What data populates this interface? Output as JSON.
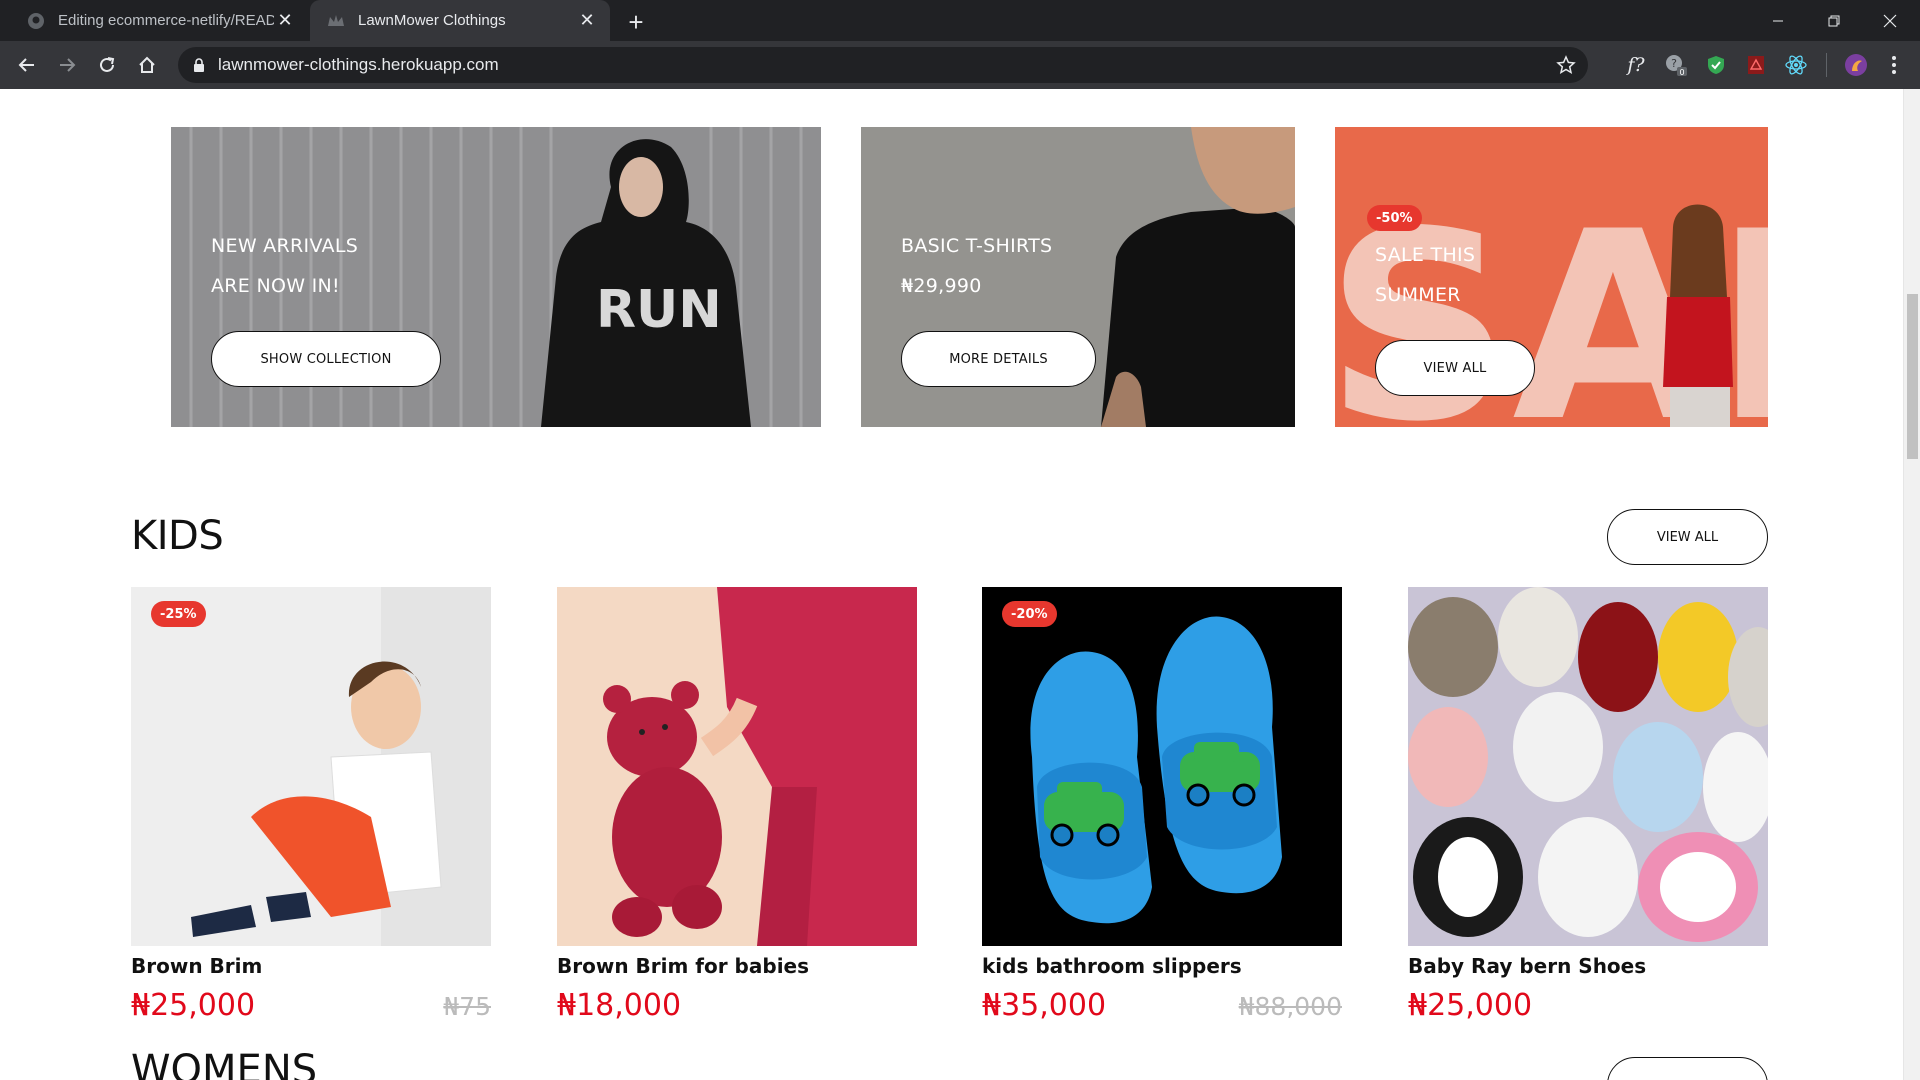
{
  "browser": {
    "tabs": [
      {
        "title": "Editing ecommerce-netlify/READ",
        "active": false,
        "favicon": "github-icon"
      },
      {
        "title": "LawnMower Clothings",
        "active": true,
        "favicon": "crown-icon"
      }
    ],
    "url": "lawnmower-clothings.herokuapp.com"
  },
  "banners": [
    {
      "lines": [
        "NEW ARRIVALS",
        "ARE NOW IN!"
      ],
      "button": "SHOW COLLECTION"
    },
    {
      "lines": [
        "BASIC T-SHIRTS",
        "₦29,990"
      ],
      "button": "MORE DETAILS"
    },
    {
      "badge": "-50%",
      "lines": [
        "SALE THIS",
        "SUMMER"
      ],
      "button": "VIEW ALL",
      "bg_text": "SAL"
    }
  ],
  "kids": {
    "title": "KIDS",
    "view_all": "VIEW ALL",
    "products": [
      {
        "name": "Brown Brim",
        "price": "₦25,000",
        "old_price": "₦75",
        "badge": "-25%"
      },
      {
        "name": "Brown Brim for babies",
        "price": "₦18,000",
        "old_price": "",
        "badge": ""
      },
      {
        "name": "kids bathroom slippers",
        "price": "₦35,000",
        "old_price": "₦88,000",
        "badge": "-20%"
      },
      {
        "name": "Baby Ray bern Shoes",
        "price": "₦25,000",
        "old_price": "",
        "badge": ""
      }
    ]
  },
  "next_section": {
    "title": "WOMENS"
  },
  "colors": {
    "accent_red": "#e1091b",
    "badge_red": "#e7372e",
    "chrome_dark": "#202124",
    "chrome_toolbar": "#35363a"
  }
}
